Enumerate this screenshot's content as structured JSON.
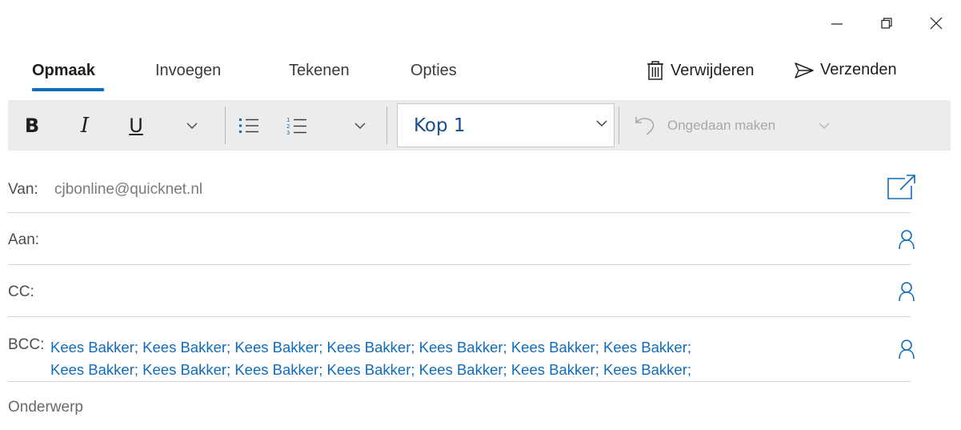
{
  "window_controls": {
    "minimize_icon": "minimize-icon",
    "restore_icon": "restore-icon",
    "close_icon": "close-icon"
  },
  "tabs": [
    {
      "label": "Opmaak",
      "active": true
    },
    {
      "label": "Invoegen",
      "active": false
    },
    {
      "label": "Tekenen",
      "active": false
    },
    {
      "label": "Opties",
      "active": false
    }
  ],
  "actions": {
    "delete_label": "Verwijderen",
    "send_label": "Verzenden"
  },
  "toolbar": {
    "bold": "B",
    "italic": "I",
    "underline": "U",
    "style_value": "Kop 1",
    "undo_label": "Ongedaan maken"
  },
  "colors": {
    "accent": "#0f6cbd",
    "toolbar_bg": "#ececec"
  },
  "fields": {
    "from_label": "Van:",
    "from_value": "cjbonline@quicknet.nl",
    "to_label": "Aan:",
    "cc_label": "CC:",
    "bcc_label": "BCC:",
    "bcc_line1": "Kees Bakker; Kees Bakker; Kees Bakker; Kees Bakker; Kees Bakker; Kees Bakker; Kees Bakker;",
    "bcc_line2": "Kees Bakker; Kees Bakker; Kees Bakker; Kees Bakker; Kees Bakker; Kees Bakker; Kees Bakker;",
    "subject_placeholder": "Onderwerp"
  }
}
